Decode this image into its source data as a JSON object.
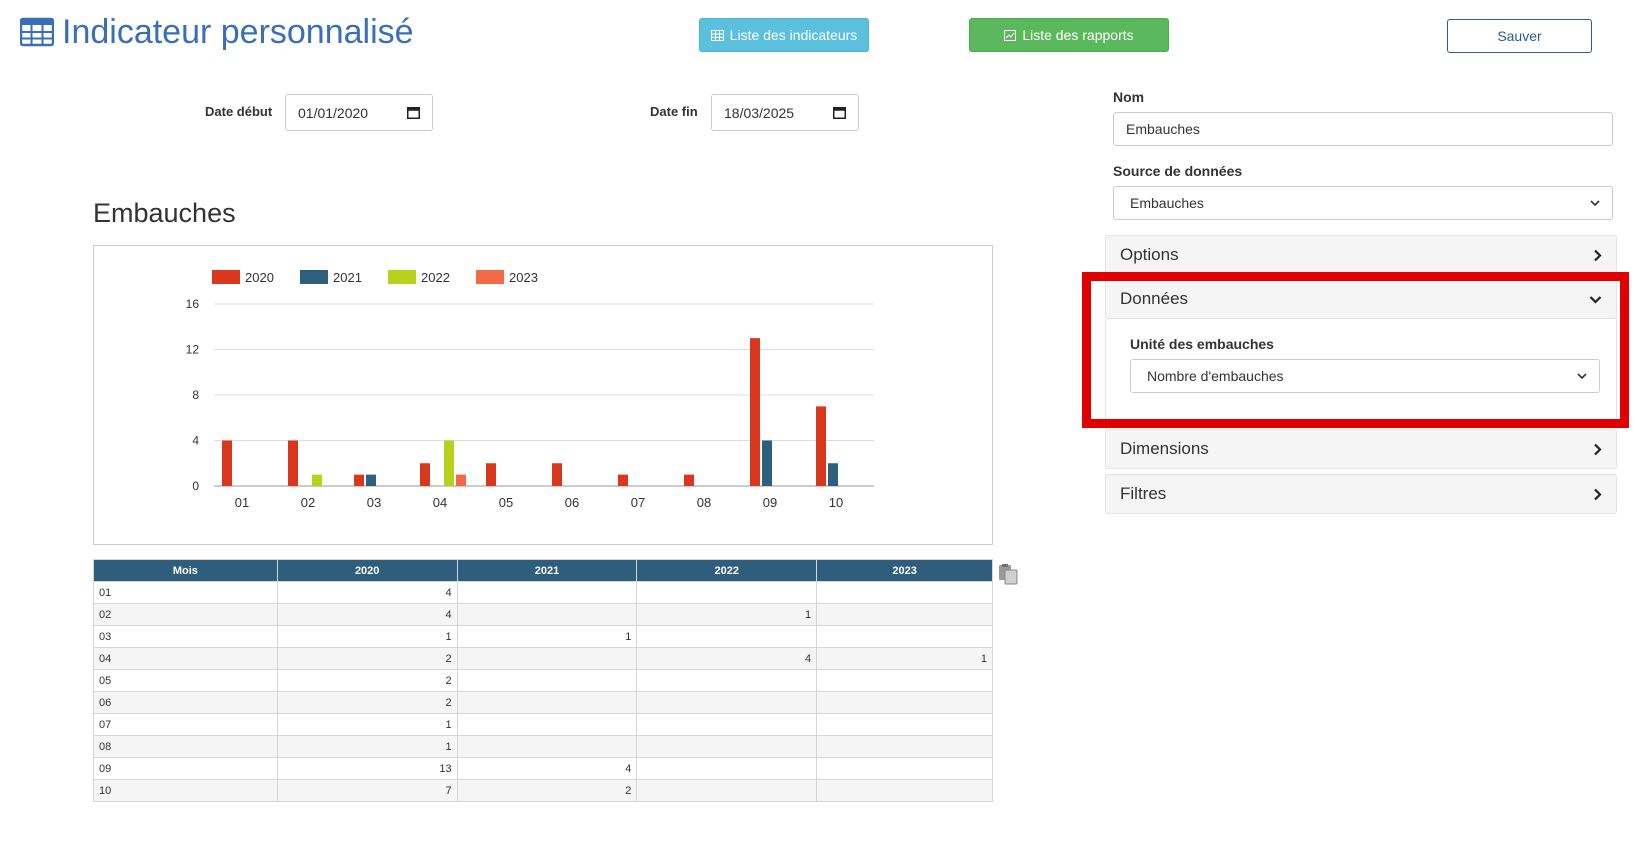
{
  "header": {
    "title": "Indicateur personnalisé",
    "btn_indicateurs": "Liste des indicateurs",
    "btn_rapports": "Liste des rapports",
    "btn_save": "Sauver"
  },
  "filters": {
    "date_start_label": "Date début",
    "date_start_value": "01/01/2020",
    "date_end_label": "Date fin",
    "date_end_value": "18/03/2025"
  },
  "chart_heading": "Embauches",
  "chart_data": {
    "type": "bar",
    "categories": [
      "01",
      "02",
      "03",
      "04",
      "05",
      "06",
      "07",
      "08",
      "09",
      "10"
    ],
    "series": [
      {
        "name": "2020",
        "color": "#d9381e",
        "values": [
          4,
          4,
          1,
          2,
          2,
          2,
          1,
          1,
          13,
          7
        ]
      },
      {
        "name": "2021",
        "color": "#2e5f7e",
        "values": [
          0,
          0,
          1,
          0,
          0,
          0,
          0,
          0,
          4,
          2
        ]
      },
      {
        "name": "2022",
        "color": "#b7d11d",
        "values": [
          0,
          1,
          0,
          4,
          0,
          0,
          0,
          0,
          0,
          0
        ]
      },
      {
        "name": "2023",
        "color": "#f26b44",
        "values": [
          0,
          0,
          0,
          1,
          0,
          0,
          0,
          0,
          0,
          0
        ]
      }
    ],
    "ylim": [
      0,
      16
    ],
    "yticks": [
      0,
      4,
      8,
      12,
      16
    ],
    "legend": "top-left",
    "grid": true
  },
  "table": {
    "headers": [
      "Mois",
      "2020",
      "2021",
      "2022",
      "2023"
    ],
    "rows": [
      [
        "01",
        "4",
        "",
        "",
        ""
      ],
      [
        "02",
        "4",
        "",
        "1",
        ""
      ],
      [
        "03",
        "1",
        "1",
        "",
        ""
      ],
      [
        "04",
        "2",
        "",
        "4",
        "1"
      ],
      [
        "05",
        "2",
        "",
        "",
        ""
      ],
      [
        "06",
        "2",
        "",
        "",
        ""
      ],
      [
        "07",
        "1",
        "",
        "",
        ""
      ],
      [
        "08",
        "1",
        "",
        "",
        ""
      ],
      [
        "09",
        "13",
        "4",
        "",
        ""
      ],
      [
        "10",
        "7",
        "2",
        "",
        ""
      ]
    ]
  },
  "config": {
    "name_label": "Nom",
    "name_value": "Embauches",
    "source_label": "Source de données",
    "source_value": "Embauches",
    "panels": {
      "options": "Options",
      "donnees": "Données",
      "dimensions": "Dimensions",
      "filtres": "Filtres"
    },
    "unit_label": "Unité des embauches",
    "unit_value": "Nombre d'embauches"
  },
  "colors": {
    "title_blue": "#3a6fb8",
    "info": "#5bc0de",
    "success": "#5cb85c",
    "table_header": "#2f5d7c",
    "highlight": "#e00000"
  }
}
